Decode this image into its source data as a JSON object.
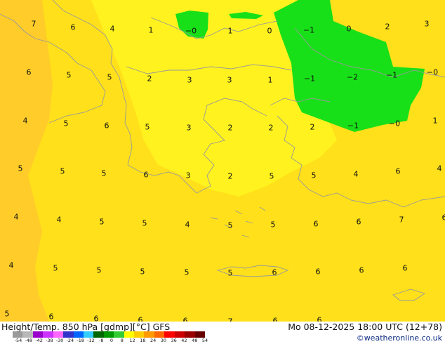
{
  "map": {
    "colors": {
      "band_orange": "#ffcc2a",
      "band_yellow_orange": "#ffe01a",
      "band_yellow": "#fff21e",
      "band_green": "#18e018",
      "coastline": "#9a9a9a"
    },
    "labels": [
      {
        "text": "7"
      },
      {
        "text": "6"
      },
      {
        "text": "4"
      },
      {
        "text": "1"
      },
      {
        "text": "−0"
      },
      {
        "text": "1"
      },
      {
        "text": "0"
      },
      {
        "text": "−1"
      },
      {
        "text": "0"
      },
      {
        "text": "2"
      },
      {
        "text": "3"
      },
      {
        "text": "6"
      },
      {
        "text": "5"
      },
      {
        "text": "5"
      },
      {
        "text": "2"
      },
      {
        "text": "3"
      },
      {
        "text": "3"
      },
      {
        "text": "1"
      },
      {
        "text": "−1"
      },
      {
        "text": "−2"
      },
      {
        "text": "−1"
      },
      {
        "text": "−0"
      },
      {
        "text": "4"
      },
      {
        "text": "5"
      },
      {
        "text": "6"
      },
      {
        "text": "5"
      },
      {
        "text": "3"
      },
      {
        "text": "2"
      },
      {
        "text": "2"
      },
      {
        "text": "2"
      },
      {
        "text": "−1"
      },
      {
        "text": "−0"
      },
      {
        "text": "1"
      },
      {
        "text": "5"
      },
      {
        "text": "5"
      },
      {
        "text": "5"
      },
      {
        "text": "6"
      },
      {
        "text": "3"
      },
      {
        "text": "2"
      },
      {
        "text": "5"
      },
      {
        "text": "5"
      },
      {
        "text": "4"
      },
      {
        "text": "6"
      },
      {
        "text": "4"
      },
      {
        "text": "4"
      },
      {
        "text": "4"
      },
      {
        "text": "5"
      },
      {
        "text": "5"
      },
      {
        "text": "4"
      },
      {
        "text": "5"
      },
      {
        "text": "5"
      },
      {
        "text": "6"
      },
      {
        "text": "6"
      },
      {
        "text": "7"
      },
      {
        "text": "6"
      },
      {
        "text": "4"
      },
      {
        "text": "5"
      },
      {
        "text": "5"
      },
      {
        "text": "5"
      },
      {
        "text": "5"
      },
      {
        "text": "5"
      },
      {
        "text": "6"
      },
      {
        "text": "6"
      },
      {
        "text": "6"
      },
      {
        "text": "6"
      },
      {
        "text": "5"
      },
      {
        "text": "6"
      },
      {
        "text": "6"
      },
      {
        "text": "6"
      },
      {
        "text": "6"
      },
      {
        "text": "7"
      },
      {
        "text": "6"
      },
      {
        "text": "6"
      }
    ]
  },
  "footer": {
    "title_left": "Height/Temp. 850 hPa [gdmp][°C] GFS",
    "title_right": "Mo 08-12-2025 18:00 UTC (12+78)",
    "credit": "©weatheronline.co.uk"
  },
  "scale": {
    "ticks": [
      "-54",
      "-48",
      "-42",
      "-38",
      "-30",
      "-24",
      "-18",
      "-12",
      "-8",
      "0",
      "8",
      "12",
      "18",
      "24",
      "30",
      "36",
      "42",
      "48",
      "54"
    ],
    "colors": [
      "#9a9a9a",
      "#b8b8b8",
      "#9900cc",
      "#cc33ff",
      "#ff66ff",
      "#3333cc",
      "#0066ff",
      "#33ccff",
      "#006600",
      "#009900",
      "#33cc33",
      "#ffff00",
      "#ffcc00",
      "#ff9900",
      "#ff6600",
      "#ff0000",
      "#cc0000",
      "#990000",
      "#660000"
    ]
  }
}
